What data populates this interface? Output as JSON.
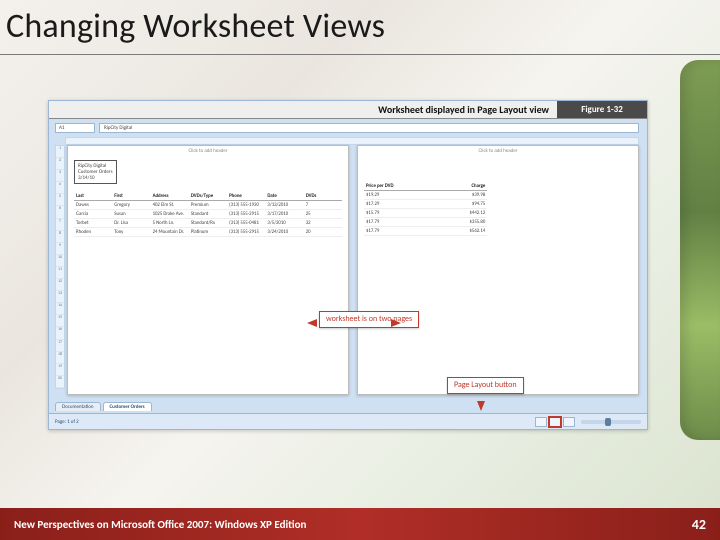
{
  "slide": {
    "title": "Changing Worksheet Views",
    "footer_left": "New Perspectives on Microsoft Office 2007: Windows XP Edition",
    "page_number": "42"
  },
  "figure": {
    "caption": "Worksheet displayed in Page Layout view",
    "label": "Figure 1-32",
    "name_box": "A1",
    "formula_bar": "RipCity Digital",
    "page_hint_left": "Click to add header",
    "page_hint_right": "Click to add header",
    "company_block": {
      "name": "RipCity Digital",
      "line2": "Customer Orders",
      "line3": "3/14/10"
    },
    "columns_left": [
      "Last",
      "First",
      "Address",
      "DVDs/Type",
      "Phone",
      "Date",
      "DVDs"
    ],
    "rows_left": [
      [
        "Dawes",
        "Gregory",
        "402 Elm St.",
        "Premium",
        "(313) 555-1930",
        "3/13/2010",
        "7"
      ],
      [
        "Garcia",
        "Susan",
        "1025 Drake Ave.",
        "Standard",
        "(313) 555-2915",
        "3/17/2010",
        "25"
      ],
      [
        "Torbet",
        "Dr. Lisa",
        "5 North Ln.",
        "Standard/Rx",
        "(313) 555-0481",
        "3/5/2010",
        "32"
      ],
      [
        "Rhoden",
        "Tony",
        "24 Mountain Dr.",
        "Platinum",
        "(313) 555-2915",
        "3/24/2010",
        "20"
      ]
    ],
    "columns_right": [
      "Price per DVD",
      "Charge"
    ],
    "rows_right": [
      [
        "$19.29",
        "$39.98"
      ],
      [
        "$17.29",
        "$94.75"
      ],
      [
        "$15.79",
        "$442.12"
      ],
      [
        "$17.79",
        "$355.80"
      ],
      [
        "$17.79",
        "$562.14"
      ]
    ],
    "sheet_tabs": [
      "Documentation",
      "Customer Orders"
    ],
    "active_tab": 1,
    "status_left": "Page: 1 of 2"
  },
  "callouts": {
    "two_pages": "worksheet is on two pages",
    "page_layout_btn": "Page Layout button"
  }
}
